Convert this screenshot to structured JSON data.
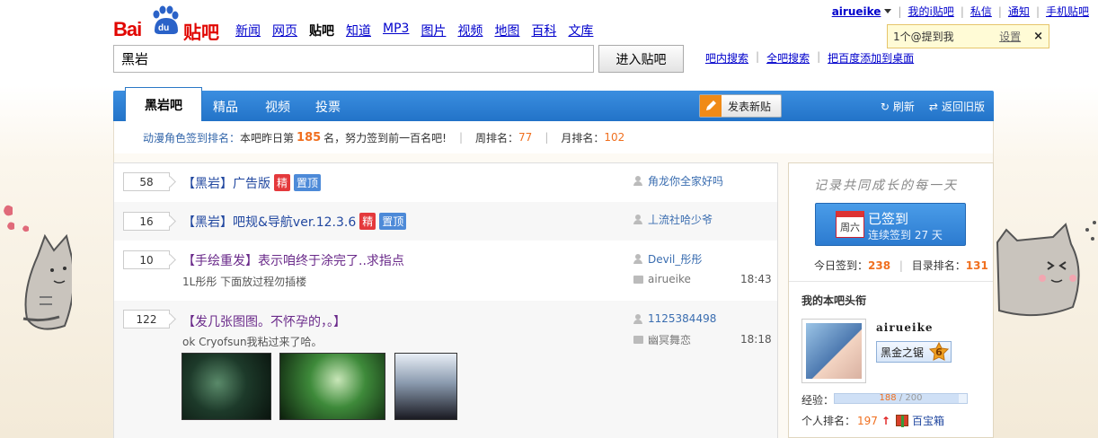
{
  "logo": {
    "text_bai": "Bai",
    "text_du": "du",
    "text_tieba": "贴吧"
  },
  "topnav": [
    {
      "label": "新闻",
      "current": false
    },
    {
      "label": "网页",
      "current": false
    },
    {
      "label": "贴吧",
      "current": true
    },
    {
      "label": "知道",
      "current": false
    },
    {
      "label": "MP3",
      "current": false
    },
    {
      "label": "图片",
      "current": false
    },
    {
      "label": "视频",
      "current": false
    },
    {
      "label": "地图",
      "current": false
    },
    {
      "label": "百科",
      "current": false
    },
    {
      "label": "文库",
      "current": false
    }
  ],
  "userbar": {
    "username": "airueike",
    "my_i": "我的i贴吧",
    "msg": "私信",
    "notify": "通知",
    "mobile": "手机贴吧"
  },
  "tip": {
    "text": "1个@提到我",
    "settings": "设置",
    "close": "×"
  },
  "search": {
    "value": "黑岩",
    "button": "进入贴吧",
    "links": [
      "吧内搜索",
      "全吧搜索",
      "把百度添加到桌面"
    ]
  },
  "tabs": {
    "active": "黑岩吧",
    "items": [
      "精品",
      "视频",
      "投票"
    ],
    "post_button": "发表新贴",
    "refresh": "刷新",
    "old": "返回旧版"
  },
  "rankbar": {
    "label": "动漫角色签到排名：",
    "pre": "本吧昨日第",
    "rank": "185",
    "post": "名，努力签到前一百名吧!",
    "week_label": "周排名：",
    "week": "77",
    "month_label": "月排名：",
    "month": "102"
  },
  "threads": [
    {
      "replies": "58",
      "title": "【黑岩】广告版",
      "jing": "精",
      "top": "置顶",
      "author": "角龙你全家好吗",
      "sub": "",
      "last": "",
      "time": ""
    },
    {
      "replies": "16",
      "title": "【黑岩】吧规&导航ver.12.3.6",
      "jing": "精",
      "top": "置顶",
      "author": "丄流社哈少爷",
      "sub": "",
      "last": "",
      "time": ""
    },
    {
      "replies": "10",
      "title": "【手绘重发】表示咱终于涂完了..求指点",
      "jing": "",
      "top": "",
      "author": "Devil_彤彤",
      "sub": "1L彤彤 下面放过程勿插楼",
      "last": "airueike",
      "time": "18:43"
    },
    {
      "replies": "122",
      "title": "【发几张图图。不怀孕的，。】",
      "jing": "",
      "top": "",
      "author": "1125384498",
      "sub": "ok Cryofsun我粘过来了哈。",
      "last": "幽冥舞恋",
      "time": "18:18"
    }
  ],
  "sidebar": {
    "slogan": "记录共同成长的每一天",
    "cal_day": "周六",
    "signed": "已签到",
    "streak": "连续签到 27 天",
    "today_label": "今日签到：",
    "today": "238",
    "dir_label": "目录排名：",
    "dir": "131",
    "head_title": "我的本吧头衔",
    "name": "airueike",
    "badge": "黑金之锯",
    "level": "6",
    "exp_label": "经验：",
    "exp_cur": "188",
    "exp_max": "/ 200",
    "exp_progress": 0.94,
    "rank_label": "个人排名：",
    "rank": "197",
    "up": "↑",
    "treasure": "百宝箱"
  },
  "colors": {
    "accent": "#2273c8",
    "orange": "#f07020",
    "red": "#e4393c"
  }
}
